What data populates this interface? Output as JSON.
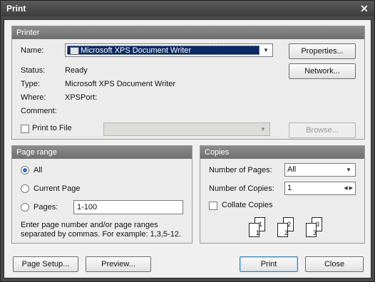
{
  "window": {
    "title": "Print",
    "close_glyph": "✕"
  },
  "printer": {
    "group_title": "Printer",
    "name_label": "Name:",
    "name_value": "Microsoft XPS Document Writer",
    "status_label": "Status:",
    "status_value": "Ready",
    "type_label": "Type:",
    "type_value": "Microsoft XPS Document Writer",
    "where_label": "Where:",
    "where_value": "XPSPort:",
    "comment_label": "Comment:",
    "comment_value": "",
    "print_to_file_label": "Print to File",
    "properties_button": "Properties...",
    "network_button": "Network...",
    "browse_button": "Browse..."
  },
  "page_range": {
    "group_title": "Page range",
    "all_label": "All",
    "current_page_label": "Current Page",
    "pages_label": "Pages:",
    "pages_value": "1-100",
    "selected": "All",
    "hint_line1": "Enter page number and/or page ranges",
    "hint_line2": "separated by commas. For example: 1,3,5-12."
  },
  "copies": {
    "group_title": "Copies",
    "number_of_pages_label": "Number of Pages:",
    "number_of_pages_value": "All",
    "number_of_copies_label": "Number of Copies:",
    "number_of_copies_value": "1",
    "collate_label": "Collate Copies",
    "collate_checked": false,
    "collate_pages": [
      "1",
      "1",
      "2",
      "2",
      "3",
      "3"
    ]
  },
  "buttons": {
    "page_setup": "Page Setup...",
    "preview": "Preview...",
    "print": "Print",
    "close": "Close"
  }
}
